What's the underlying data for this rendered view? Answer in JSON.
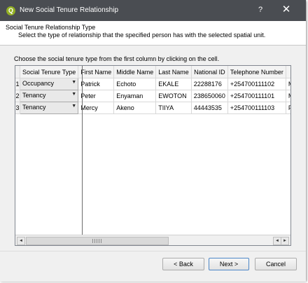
{
  "window": {
    "title": "New Social Tenure Relationship",
    "help_glyph": "?",
    "close_glyph": "✕",
    "app_icon_glyph": "Q"
  },
  "header": {
    "title": "Social Tenure Relationship Type",
    "subtitle": "Select the type of relationship that the specified person has with the selected spatial unit."
  },
  "instructions": "Choose the social tenure type from the first column by clicking on the cell.",
  "table": {
    "columns": [
      "Social Tenure Type",
      "First Name",
      "Middle Name",
      "Last Name",
      "National ID",
      "Telephone Number",
      ""
    ],
    "rows": [
      {
        "num": "1",
        "tenure": "Occupancy",
        "first": "Patrick",
        "middle": "Echoto",
        "last": "EKALE",
        "national_id": "22288176",
        "phone": "+254700111102",
        "extra": "M"
      },
      {
        "num": "2",
        "tenure": "Tenancy",
        "first": "Peter",
        "middle": "Enyaman",
        "last": "EWOTON",
        "national_id": "238650060",
        "phone": "+254700111101",
        "extra": "M"
      },
      {
        "num": "3",
        "tenure": "Tenancy",
        "first": "Mercy",
        "middle": "Akeno",
        "last": "TIIYA",
        "national_id": "44443535",
        "phone": "+254700111103",
        "extra": "Fe"
      }
    ],
    "dropdown_glyph": "▼"
  },
  "scrollbar": {
    "left_glyph": "◄",
    "right_glyph": "►"
  },
  "buttons": {
    "back": "< Back",
    "next": "Next >",
    "cancel": "Cancel"
  },
  "colors": {
    "titlebar": "#4a4d52",
    "app_icon": "#93b023",
    "primary_button_border": "#4d87c7"
  }
}
